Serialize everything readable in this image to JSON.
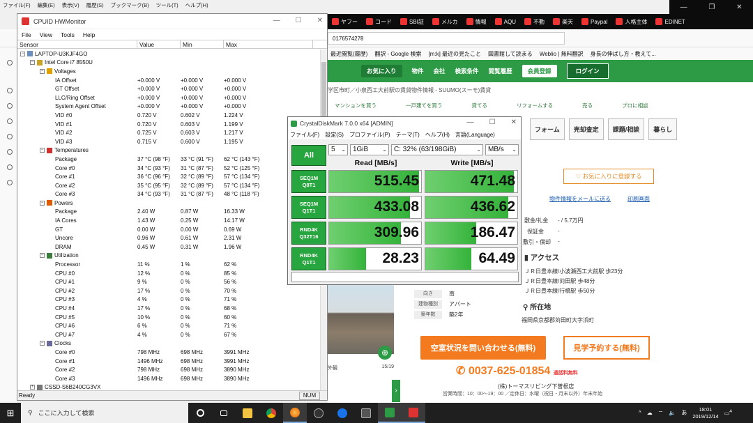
{
  "firefox": {
    "menu": [
      "ファイル(F)",
      "編集(E)",
      "表示(V)",
      "履歴(S)",
      "ブックマーク(B)",
      "ツール(T)",
      "ヘルプ(H)"
    ],
    "tabs": [
      "ヤフー",
      "コード",
      "SBI証",
      "メルカ",
      "情報",
      "AQU",
      "不動",
      "楽天",
      "Paypal",
      "人格主体",
      "EDINET"
    ],
    "url": "0176574278",
    "bookmarks": [
      "最近閲覧(履歴)",
      "翻訳 - Google 検索",
      "[m:k] 最近の見たこと",
      "図書館して読まる",
      "Weblio | 無料翻訳",
      "身長の伸ばし方・教えて..."
    ]
  },
  "site": {
    "nav": [
      "お気に入り",
      "物件",
      "会社",
      "検索条件",
      "閲覧履歴",
      "会員登録",
      "ログイン"
    ],
    "breadcrumb": "学区市町／小泉西工大前駅の賃貸物件情報 - SUUMO(スーモ)賃貸",
    "subnav": [
      "マンションを買う",
      "一戸建てを買う",
      "貸てる",
      "リフォームする",
      "売る",
      "プロに相談"
    ],
    "cats": [
      "フォーム",
      "売却査定",
      "課題/相談",
      "暮らし"
    ],
    "fav_button": "お気に入りに登録する",
    "mail_link": "物件情報をメールに送る",
    "print_link": "印刷画面",
    "cost_lab": "敷金/礼金",
    "cost_val": "- / 5.7万円",
    "deposit_lab": "保証金",
    "deposit_val": "-",
    "keymoney_lab": "敷引・償却",
    "keymoney_val": "-",
    "access_title": "アクセス",
    "access": [
      "ＪＲ日豊本線/小波瀬西工大前駅 歩23分",
      "ＪＲ日豊本線/苅田駅 歩48分",
      "ＪＲ日豊本線/行橋駅 歩50分"
    ],
    "direction_lab": "向き",
    "direction_val": "南",
    "type_lab": "建物種別",
    "type_val": "アパート",
    "age_lab": "築年数",
    "age_val": "築2年",
    "location_title": "所在地",
    "location": "福岡県京都郡苅田町大字浜町",
    "photo_caption": "外観",
    "photo_count": "15/19",
    "inquiry_button": "空室状況を問い合わせる(無料)",
    "visit_button": "見学予約する(無料)",
    "phone": "0037-625-01854",
    "phone_note": "通話料無料",
    "company": "(株)トーマスリビング下曽根店",
    "hours": "営業時間：10：00～19：00 ／定休日：水曜（祝日・月末以外）年末年始"
  },
  "hwmonitor": {
    "title": "CPUID HWMonitor",
    "menu": [
      "File",
      "View",
      "Tools",
      "Help"
    ],
    "columns": [
      "Sensor",
      "Value",
      "Min",
      "Max"
    ],
    "rows": [
      {
        "l": 0,
        "tw": "−",
        "ic": "pc",
        "n": "LAPTOP-U3KJF4GO",
        "v": "",
        "mn": "",
        "mx": ""
      },
      {
        "l": 1,
        "tw": "−",
        "ic": "chip",
        "n": "Intel Core i7 8550U",
        "v": "",
        "mn": "",
        "mx": ""
      },
      {
        "l": 2,
        "tw": "−",
        "ic": "volt",
        "n": "Voltages",
        "v": "",
        "mn": "",
        "mx": ""
      },
      {
        "l": 3,
        "n": "IA Offset",
        "v": "+0.000 V",
        "mn": "+0.000 V",
        "mx": "+0.000 V"
      },
      {
        "l": 3,
        "n": "GT Offset",
        "v": "+0.000 V",
        "mn": "+0.000 V",
        "mx": "+0.000 V"
      },
      {
        "l": 3,
        "n": "LLC/Ring Offset",
        "v": "+0.000 V",
        "mn": "+0.000 V",
        "mx": "+0.000 V"
      },
      {
        "l": 3,
        "n": "System Agent Offset",
        "v": "+0.000 V",
        "mn": "+0.000 V",
        "mx": "+0.000 V"
      },
      {
        "l": 3,
        "n": "VID #0",
        "v": "0.720 V",
        "mn": "0.602 V",
        "mx": "1.224 V"
      },
      {
        "l": 3,
        "n": "VID #1",
        "v": "0.720 V",
        "mn": "0.603 V",
        "mx": "1.199 V"
      },
      {
        "l": 3,
        "n": "VID #2",
        "v": "0.725 V",
        "mn": "0.603 V",
        "mx": "1.217 V"
      },
      {
        "l": 3,
        "n": "VID #3",
        "v": "0.715 V",
        "mn": "0.600 V",
        "mx": "1.195 V"
      },
      {
        "l": 2,
        "tw": "−",
        "ic": "temp",
        "n": "Temperatures",
        "v": "",
        "mn": "",
        "mx": ""
      },
      {
        "l": 3,
        "n": "Package",
        "v": "37 °C  (98 °F)",
        "mn": "33 °C  (91 °F)",
        "mx": "62 °C  (143 °F)"
      },
      {
        "l": 3,
        "n": "Core #0",
        "v": "34 °C  (93 °F)",
        "mn": "31 °C  (87 °F)",
        "mx": "52 °C  (125 °F)"
      },
      {
        "l": 3,
        "n": "Core #1",
        "v": "36 °C  (96 °F)",
        "mn": "32 °C  (89 °F)",
        "mx": "57 °C  (134 °F)"
      },
      {
        "l": 3,
        "n": "Core #2",
        "v": "35 °C  (95 °F)",
        "mn": "32 °C  (89 °F)",
        "mx": "57 °C  (134 °F)"
      },
      {
        "l": 3,
        "n": "Core #3",
        "v": "34 °C  (93 °F)",
        "mn": "31 °C  (87 °F)",
        "mx": "48 °C  (118 °F)"
      },
      {
        "l": 2,
        "tw": "−",
        "ic": "power",
        "n": "Powers",
        "v": "",
        "mn": "",
        "mx": ""
      },
      {
        "l": 3,
        "n": "Package",
        "v": "2.40 W",
        "mn": "0.87 W",
        "mx": "16.33 W"
      },
      {
        "l": 3,
        "n": "IA Cores",
        "v": "1.43 W",
        "mn": "0.25 W",
        "mx": "14.17 W"
      },
      {
        "l": 3,
        "n": "GT",
        "v": "0.00 W",
        "mn": "0.00 W",
        "mx": "0.69 W"
      },
      {
        "l": 3,
        "n": "Uncore",
        "v": "0.96 W",
        "mn": "0.61 W",
        "mx": "2.31 W"
      },
      {
        "l": 3,
        "n": "DRAM",
        "v": "0.45 W",
        "mn": "0.31 W",
        "mx": "1.96 W"
      },
      {
        "l": 2,
        "tw": "−",
        "ic": "util",
        "n": "Utilization",
        "v": "",
        "mn": "",
        "mx": ""
      },
      {
        "l": 3,
        "n": "Processor",
        "v": "11 %",
        "mn": "1 %",
        "mx": "62 %"
      },
      {
        "l": 3,
        "n": "CPU #0",
        "v": "12 %",
        "mn": "0 %",
        "mx": "85 %"
      },
      {
        "l": 3,
        "n": "CPU #1",
        "v": "9 %",
        "mn": "0 %",
        "mx": "56 %"
      },
      {
        "l": 3,
        "n": "CPU #2",
        "v": "17 %",
        "mn": "0 %",
        "mx": "70 %"
      },
      {
        "l": 3,
        "n": "CPU #3",
        "v": "4 %",
        "mn": "0 %",
        "mx": "71 %"
      },
      {
        "l": 3,
        "n": "CPU #4",
        "v": "17 %",
        "mn": "0 %",
        "mx": "68 %"
      },
      {
        "l": 3,
        "n": "CPU #5",
        "v": "10 %",
        "mn": "0 %",
        "mx": "60 %"
      },
      {
        "l": 3,
        "n": "CPU #6",
        "v": "6 %",
        "mn": "0 %",
        "mx": "71 %"
      },
      {
        "l": 3,
        "n": "CPU #7",
        "v": "4 %",
        "mn": "0 %",
        "mx": "67 %"
      },
      {
        "l": 2,
        "tw": "−",
        "ic": "clock",
        "n": "Clocks",
        "v": "",
        "mn": "",
        "mx": ""
      },
      {
        "l": 3,
        "n": "Core #0",
        "v": "798 MHz",
        "mn": "698 MHz",
        "mx": "3991 MHz"
      },
      {
        "l": 3,
        "n": "Core #1",
        "v": "1496 MHz",
        "mn": "698 MHz",
        "mx": "3991 MHz"
      },
      {
        "l": 3,
        "n": "Core #2",
        "v": "798 MHz",
        "mn": "698 MHz",
        "mx": "3890 MHz"
      },
      {
        "l": 3,
        "n": "Core #3",
        "v": "1496 MHz",
        "mn": "698 MHz",
        "mx": "3890 MHz"
      },
      {
        "l": 1,
        "tw": "+",
        "ic": "disk",
        "n": "CSSD-S6B240CG3VX",
        "v": "",
        "mn": "",
        "mx": ""
      }
    ],
    "status": "Ready",
    "num": "NUM"
  },
  "cdm": {
    "title": "CrystalDiskMark 7.0.0 x64 [ADMIN]",
    "menu": [
      "ファイル(F)",
      "設定(S)",
      "プロファイル(P)",
      "テーマ(T)",
      "ヘルプ(H)",
      "言語(Language)"
    ],
    "all_label": "All",
    "count": "5",
    "size": "1GiB",
    "drive": "C: 32% (63/198GiB)",
    "unit": "MB/s",
    "read_header": "Read [MB/s]",
    "write_header": "Write [MB/s]",
    "tests": [
      {
        "l1": "SEQ1M",
        "l2": "Q8T1",
        "read": "515.45",
        "write": "471.48",
        "rf": 0.98,
        "wf": 0.96
      },
      {
        "l1": "SEQ1M",
        "l2": "Q1T1",
        "read": "433.08",
        "write": "436.62",
        "rf": 0.88,
        "wf": 0.9
      },
      {
        "l1": "RND4K",
        "l2": "Q32T16",
        "read": "309.96",
        "write": "186.47",
        "rf": 0.78,
        "wf": 0.55
      },
      {
        "l1": "RND4K",
        "l2": "Q1T1",
        "read": "28.23",
        "write": "64.49",
        "rf": 0.4,
        "wf": 0.5
      }
    ],
    "bar_color": "#34b33a"
  },
  "taskbar": {
    "search_placeholder": "ここに入力して検索",
    "time": "18:01",
    "date": "2019/12/14",
    "notify_count": "4"
  }
}
